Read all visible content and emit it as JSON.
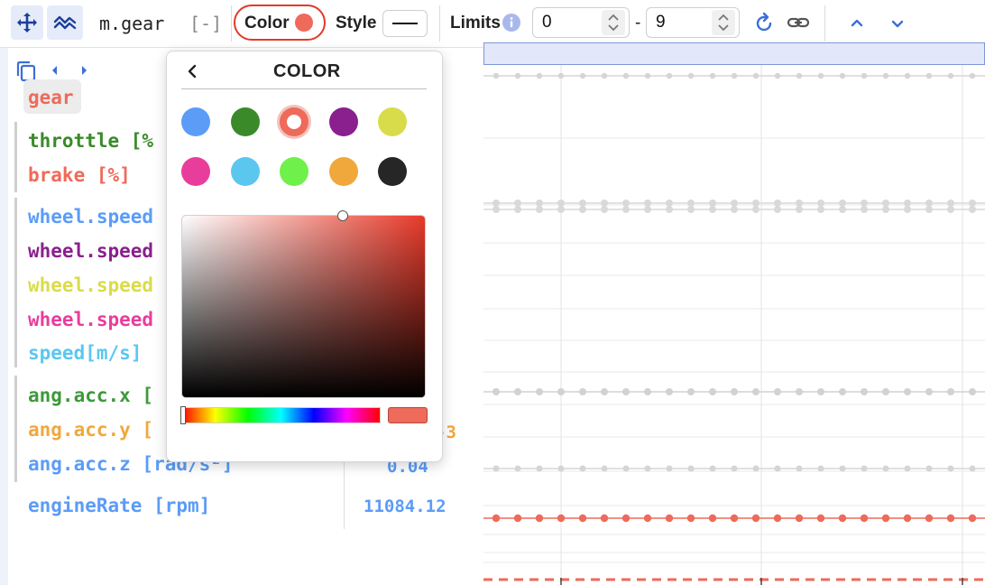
{
  "toolbar": {
    "signal_name": "m.gear",
    "collapse_label": "[-]",
    "color_label": "Color",
    "style_label": "Style",
    "limits_label": "Limits",
    "limit_min": "0",
    "limit_dash": "-",
    "limit_max": "9",
    "current_color": "#ee6a5a",
    "icons": {
      "move": "move-arrows-icon",
      "line_style": "wave-lines-icon",
      "info": "info-icon",
      "reset": "reset-icon",
      "link": "link-icon",
      "up": "chevron-up-icon",
      "down": "chevron-down-icon"
    }
  },
  "sidebar": {
    "icons": {
      "copy": "copy-icon",
      "prev": "chevron-left-icon",
      "next": "chevron-right-icon"
    },
    "selected": {
      "label": "gear",
      "color": "#ee6a5a"
    },
    "signals": [
      {
        "label": "throttle [%",
        "color": "#3a8a2a"
      },
      {
        "label": "brake [%]",
        "color": "#ee6a5a"
      },
      {
        "label": "wheel.speed",
        "color": "#5b9cf7"
      },
      {
        "label": "wheel.speed",
        "color": "#8a1f8e"
      },
      {
        "label": "wheel.speed",
        "color": "#d9dc4a"
      },
      {
        "label": "wheel.speed",
        "color": "#e93d9c"
      },
      {
        "label": "speed[m/s]",
        "color": "#5bc7ef"
      },
      {
        "label": "ang.acc.x [",
        "color": "#3d9a3a"
      },
      {
        "label": "ang.acc.y [",
        "color": "#f0a83c"
      },
      {
        "label": "ang.acc.z [rad/s²]",
        "color": "#5b9cf7"
      },
      {
        "label": "engineRate [rpm]",
        "color": "#5b9cf7"
      }
    ],
    "values": [
      {
        "text": "-3",
        "color": "#f0a83c"
      },
      {
        "text": "0.04",
        "color": "#5b9cf7"
      },
      {
        "text": "11084.12",
        "color": "#5b9cf7"
      }
    ]
  },
  "color_popover": {
    "title": "COLOR",
    "back_icon": "chevron-left-icon",
    "swatches": [
      "#5b9cf7",
      "#3a8a2a",
      "#ee6a5a",
      "#8a1f8e",
      "#d9dc4a",
      "#e93d9c",
      "#5bc7ef",
      "#6ff04a",
      "#f0a83c",
      "#262626"
    ],
    "selected_index": 2,
    "hue_color": "#e83a2a",
    "preview_color": "#ee6a5a"
  }
}
